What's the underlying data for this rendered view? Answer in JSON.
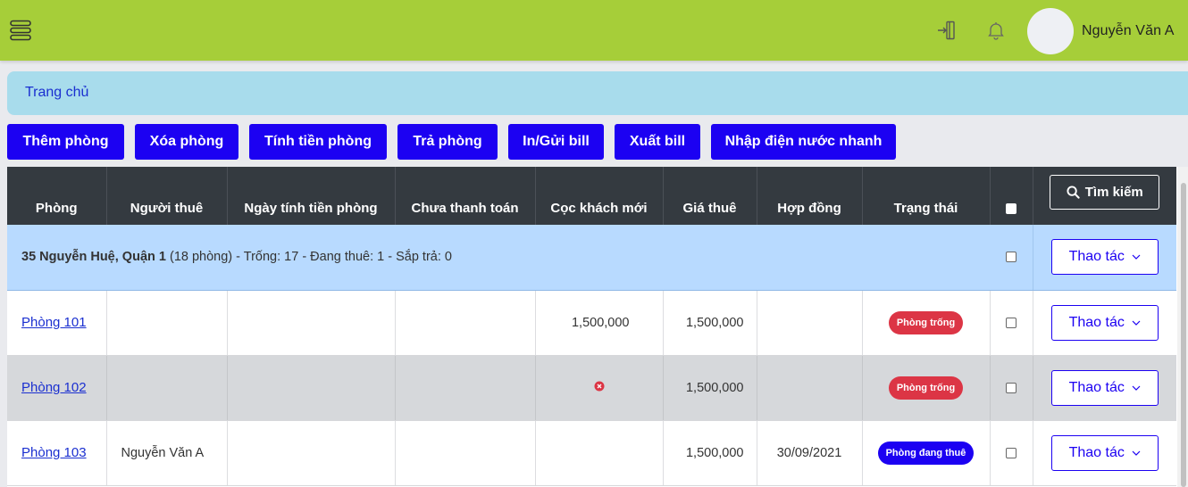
{
  "header": {
    "menu_icon": "hamburger-icon",
    "logout_icon": "logout-icon",
    "bell_icon": "bell-icon",
    "user_name": "Nguyễn Văn A",
    "bar_color": "#a6ce39"
  },
  "breadcrumb": {
    "home": "Trang chủ"
  },
  "toolbar": {
    "add_room": "Thêm phòng",
    "delete_room": "Xóa phòng",
    "calc_room": "Tính tiền phòng",
    "checkout_room": "Trả phòng",
    "print_bill": "In/Gửi bill",
    "export_bill": "Xuất bill",
    "quick_utility": "Nhập điện nước nhanh",
    "button_color": "#1c01f2"
  },
  "table": {
    "columns": [
      "Phòng",
      "Người thuê",
      "Ngày tính tiền phòng",
      "Chưa thanh toán",
      "Cọc khách mới",
      "Giá thuê",
      "Hợp đồng",
      "Trạng thái"
    ],
    "search_label": "Tìm kiếm",
    "action_label": "Thao tác",
    "group": {
      "address": "35 Nguyễn Huệ, Quận 1",
      "summary": "(18 phòng) - Trống: 17 - Đang thuê: 1 - Sắp trả: 0"
    },
    "rows": [
      {
        "room": "Phòng 101",
        "tenant": "",
        "billing_date": "",
        "unpaid": "",
        "deposit": "1,500,000",
        "price": "1,500,000",
        "contract": "",
        "status": "Phòng trống",
        "status_color": "#dc3545"
      },
      {
        "room": "Phòng 102",
        "tenant": "",
        "billing_date": "",
        "unpaid": "",
        "deposit_icon": "x-circle-icon",
        "price": "1,500,000",
        "contract": "",
        "status": "Phòng trống",
        "status_color": "#dc3545"
      },
      {
        "room": "Phòng 103",
        "tenant": "Nguyễn Văn A",
        "billing_date": "",
        "unpaid": "",
        "deposit": "",
        "price": "1,500,000",
        "contract": "30/09/2021",
        "status": "Phòng đang thuê",
        "status_color": "#1c01f2"
      }
    ]
  }
}
